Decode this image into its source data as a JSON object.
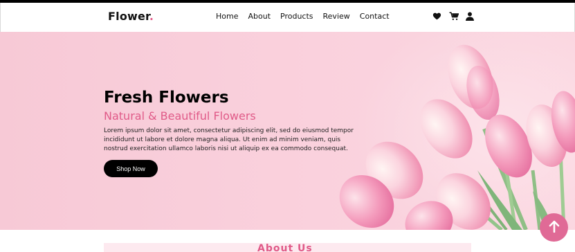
{
  "brand": {
    "name": "Flower",
    "dot": ".",
    "accent": "#e35d8a"
  },
  "nav": {
    "items": [
      "Home",
      "About",
      "Products",
      "Review",
      "Contact"
    ],
    "icons": [
      "heart-icon",
      "cart-icon",
      "user-icon"
    ]
  },
  "hero": {
    "title": "Fresh Flowers",
    "subtitle": "Natural & Beautiful Flowers",
    "description": "Lorem ipsum dolor sit amet, consectetur adipiscing elit, sed do eiusmod tempor incididunt ut labore et dolore magna aliqua. Ut enim ad minim veniam, quis nostrud exercitation ullamco laboris nisi ut aliquip ex ea commodo consequat.",
    "button": "Shop Now",
    "background": "#f9cfdb"
  },
  "next_section": {
    "heading_peek": "About Us"
  },
  "scroll_top": {
    "icon": "arrow-up-icon",
    "color": "#e06a96"
  }
}
